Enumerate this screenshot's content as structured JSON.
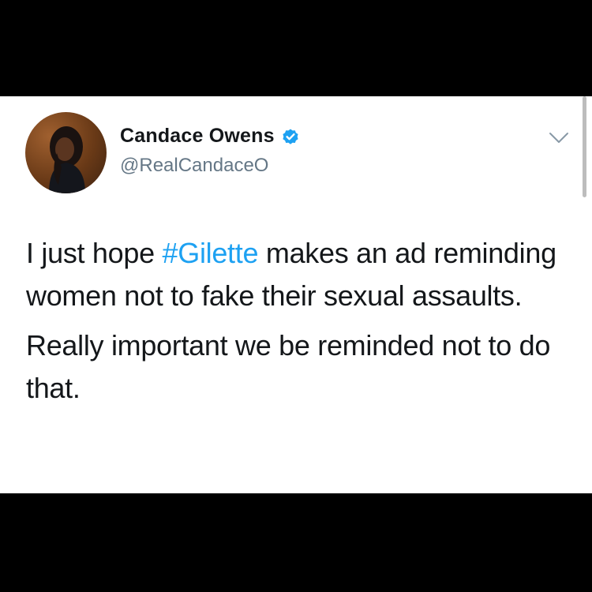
{
  "colors": {
    "background": "#000000",
    "card": "#ffffff",
    "text": "#14171a",
    "handle": "#657786",
    "link": "#1da1f2",
    "verified": "#1da1f2"
  },
  "author": {
    "name": "Candace Owens",
    "handle": "@RealCandaceO",
    "verified": true,
    "verified_icon": "verified-badge-icon",
    "avatar_icon": "profile-photo"
  },
  "menu": {
    "icon": "chevron-down-icon"
  },
  "tweet": {
    "para1_before": "I just hope ",
    "hashtag": "#Gilette",
    "para1_after": " makes an ad reminding women not to fake their sexual assaults.",
    "para2": "Really important we be reminded not to do that."
  }
}
